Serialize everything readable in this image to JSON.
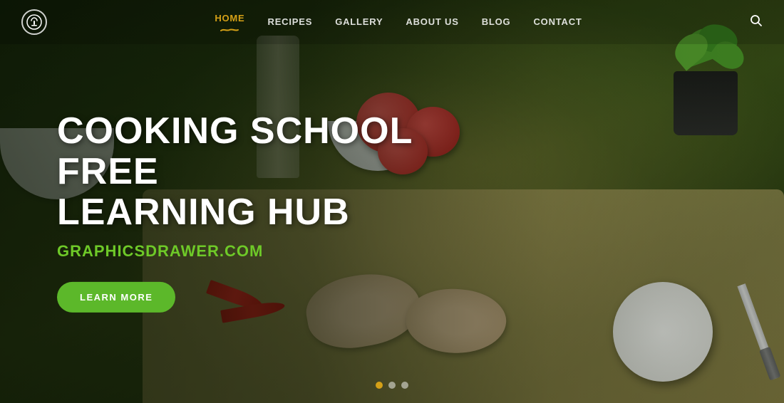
{
  "hero": {
    "title_line1": "COOKING SCHOOL FREE",
    "title_line2": "LEARNING HUB",
    "subtitle": "GRAPHICSDRAWER.COM",
    "cta_label": "LEARN MORE"
  },
  "navbar": {
    "logo_icon": "🍽",
    "links": [
      {
        "id": "home",
        "label": "HOME",
        "active": true
      },
      {
        "id": "recipes",
        "label": "RECIPES",
        "active": false
      },
      {
        "id": "gallery",
        "label": "GALLERY",
        "active": false
      },
      {
        "id": "about",
        "label": "ABOUT US",
        "active": false
      },
      {
        "id": "blog",
        "label": "BLOG",
        "active": false
      },
      {
        "id": "contact",
        "label": "CONTACT",
        "active": false
      }
    ],
    "search_icon": "🔍"
  },
  "slides": {
    "dots": [
      {
        "id": "dot1",
        "active": true
      },
      {
        "id": "dot2",
        "active": false
      },
      {
        "id": "dot3",
        "active": false
      }
    ]
  },
  "colors": {
    "accent_gold": "#d4a017",
    "accent_green": "#6ec928",
    "btn_green": "#5cb82a",
    "nav_active": "#d4a017"
  }
}
